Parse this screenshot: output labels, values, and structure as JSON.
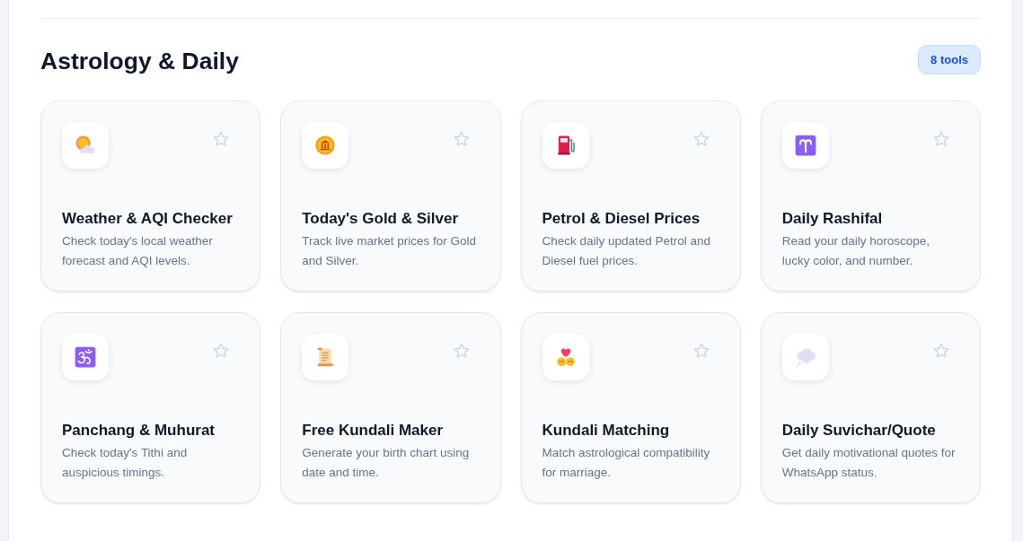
{
  "section": {
    "title": "Astrology & Daily",
    "badge": "8 tools"
  },
  "tools": [
    {
      "title": "Weather & AQI Checker",
      "description": "Check today's local weather forecast and AQI levels.",
      "favorite": false
    },
    {
      "title": "Today's Gold & Silver",
      "description": "Track live market prices for Gold and Silver.",
      "favorite": false
    },
    {
      "title": "Petrol & Diesel Prices",
      "description": "Check daily updated Petrol and Diesel fuel prices.",
      "favorite": false
    },
    {
      "title": "Daily Rashifal",
      "description": "Read your daily horoscope, lucky color, and number.",
      "favorite": false
    },
    {
      "title": "Panchang & Muhurat",
      "description": "Check today's Tithi and auspicious timings.",
      "favorite": false
    },
    {
      "title": "Free Kundali Maker",
      "description": "Generate your birth chart using date and time.",
      "favorite": false
    },
    {
      "title": "Kundali Matching",
      "description": "Match astrological compatibility for marriage.",
      "favorite": false
    },
    {
      "title": "Daily Suvichar/Quote",
      "description": "Get daily motivational quotes for WhatsApp status.",
      "favorite": false
    }
  ]
}
